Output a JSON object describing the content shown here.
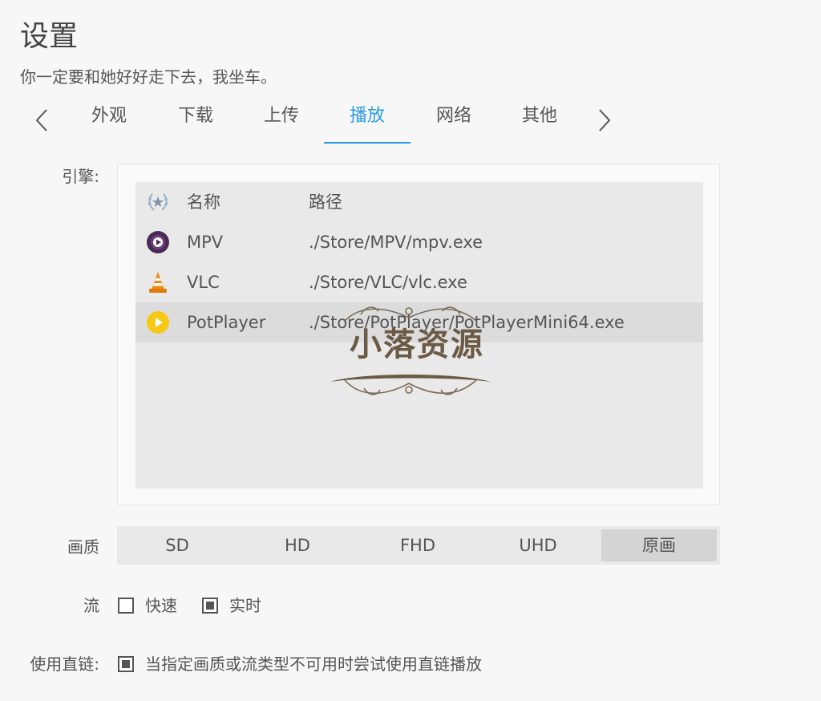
{
  "header": {
    "title": "设置",
    "subtitle": "你一定要和她好好走下去，我坐车。"
  },
  "tabs": {
    "items": [
      {
        "id": "appearance",
        "label": "外观"
      },
      {
        "id": "download",
        "label": "下载"
      },
      {
        "id": "upload",
        "label": "上传"
      },
      {
        "id": "playback",
        "label": "播放"
      },
      {
        "id": "network",
        "label": "网络"
      },
      {
        "id": "other",
        "label": "其他"
      }
    ],
    "active": "playback",
    "prev_icon": "chevron-left-icon",
    "next_icon": "chevron-right-icon",
    "accent_color": "#2b9be6"
  },
  "engine": {
    "label": "引擎:",
    "columns": {
      "icon": "laurel-icon",
      "name": "名称",
      "path": "路径"
    },
    "rows": [
      {
        "name": "MPV",
        "path": "./Store/MPV/mpv.exe",
        "icon": "mpv-icon",
        "selected": false
      },
      {
        "name": "VLC",
        "path": "./Store/VLC/vlc.exe",
        "icon": "vlc-cone-icon",
        "selected": false
      },
      {
        "name": "PotPlayer",
        "path": "./Store/PotPlayer/PotPlayerMini64.exe",
        "icon": "potplayer-icon",
        "selected": true
      }
    ]
  },
  "quality": {
    "label": "画质",
    "options": [
      "SD",
      "HD",
      "FHD",
      "UHD",
      "原画"
    ],
    "selected": "原画"
  },
  "stream": {
    "label": "流",
    "options": [
      {
        "label": "快速",
        "checked": false
      },
      {
        "label": "实时",
        "checked": true
      }
    ]
  },
  "direct_link": {
    "label": "使用直链:",
    "option": {
      "label": "当指定画质或流类型不可用时尝试使用直链播放",
      "checked": true
    }
  },
  "watermark": {
    "text": "小落资源"
  }
}
